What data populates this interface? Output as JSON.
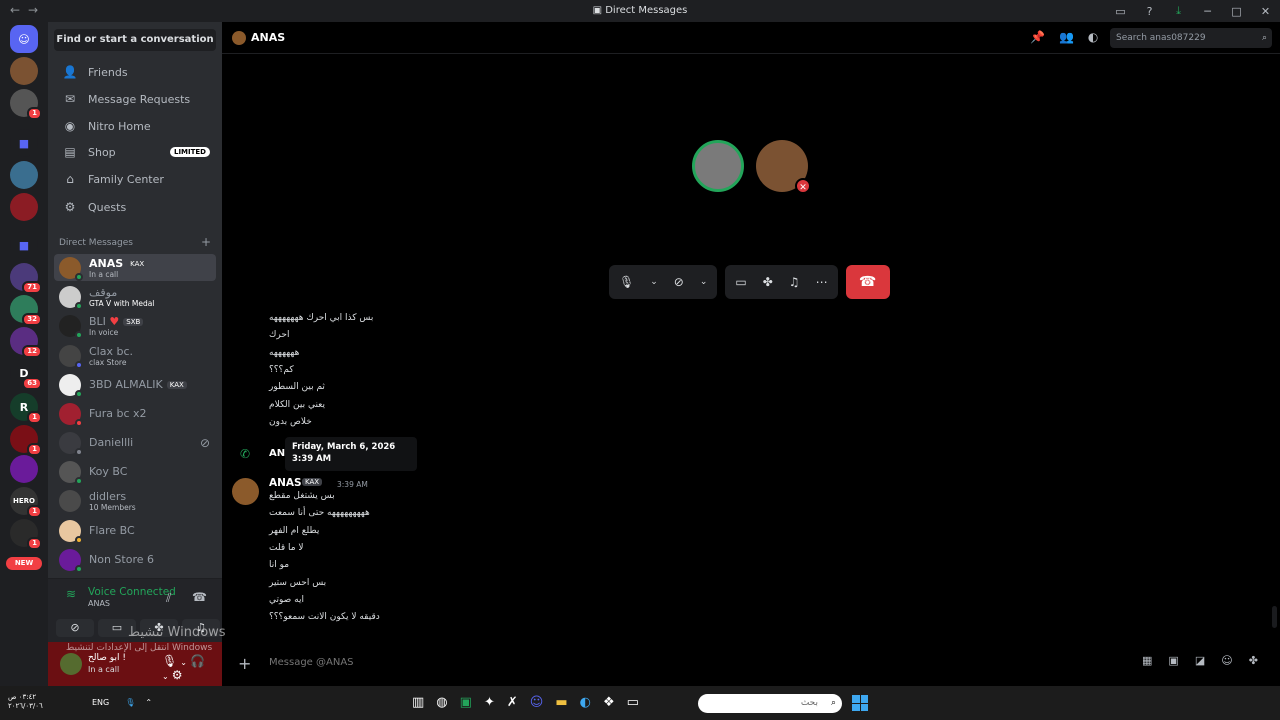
{
  "window": {
    "title": "Direct Messages"
  },
  "guild_badges": [
    "1",
    "71",
    "32",
    "12",
    "63",
    "1",
    "1",
    "1",
    "1"
  ],
  "guild_new_label": "NEW",
  "sidebar": {
    "find_button": "Find or start a conversation",
    "nav": [
      {
        "label": "Friends",
        "icon": "friends-icon"
      },
      {
        "label": "Message Requests",
        "icon": "mail-icon"
      },
      {
        "label": "Nitro Home",
        "icon": "nitro-icon"
      },
      {
        "label": "Shop",
        "icon": "shop-icon",
        "badge": "LIMITED"
      },
      {
        "label": "Family Center",
        "icon": "family-icon"
      },
      {
        "label": "Quests",
        "icon": "quests-icon"
      }
    ],
    "dm_header": "Direct Messages",
    "dms": [
      {
        "name": "ANAS",
        "tag": "KAX",
        "sub": "In a call"
      },
      {
        "name": "موقف",
        "tag": "",
        "sub": "GTA V with Medal"
      },
      {
        "name": "BLI",
        "tag": "SXB",
        "sub": "In voice"
      },
      {
        "name": "Clax bc.",
        "tag": "",
        "sub": "clax Store"
      },
      {
        "name": "3BD ALMALIK",
        "tag": "KAX",
        "sub": ""
      },
      {
        "name": "Fura bc x2",
        "tag": "",
        "sub": ""
      },
      {
        "name": "Daniellli",
        "tag": "",
        "sub": ""
      },
      {
        "name": "Koy BC",
        "tag": "",
        "sub": ""
      },
      {
        "name": "didlers",
        "tag": "",
        "sub": "10 Members"
      },
      {
        "name": "Flare BC",
        "tag": "",
        "sub": ""
      },
      {
        "name": "Non Store 6",
        "tag": "",
        "sub": ""
      }
    ],
    "voice": {
      "title": "Voice Connected",
      "channel": "ANAS"
    },
    "user": {
      "name": "ابو صالح !",
      "status": "In a call"
    }
  },
  "chat": {
    "header_name": "ANAS",
    "search_placeholder": "Search anas087229",
    "messages_top": [
      "بس كذا ابي احرك هههههههه",
      "احرك",
      "ههههههه",
      "كم؟؟؟",
      "ثم بين السطور",
      "يعني بين الكلام",
      "خلاص بدون"
    ],
    "system_name": "ANA",
    "tooltip": "Friday, March 6, 2026 3:39 AM",
    "group": {
      "author": "ANAS",
      "tag": "KAX",
      "time": "3:39 AM"
    },
    "messages_group": [
      "بس يشتغل مقطع",
      "هههههههههه حتى أنا سمعت",
      "يطلع ام الفهر",
      "لا ما قلت",
      "مو انا",
      "بس احس ستير",
      "ايه صوتي",
      "دقيقه لا يكون الانت سمعو؟؟؟"
    ],
    "composer_placeholder": "Message @ANAS"
  },
  "watermark": {
    "line1": "تنشيط Windows",
    "line2": "انتقل إلى الإعدادات لتنشيط Windows"
  },
  "taskbar": {
    "time": "٠٣:٤٢ ص",
    "date": "٢٠٢٦/٠٣/٠٦",
    "lang": "ENG",
    "search": "بحث"
  },
  "colors": {
    "accent": "#5865f2",
    "green": "#23a55a",
    "red": "#da373c"
  }
}
